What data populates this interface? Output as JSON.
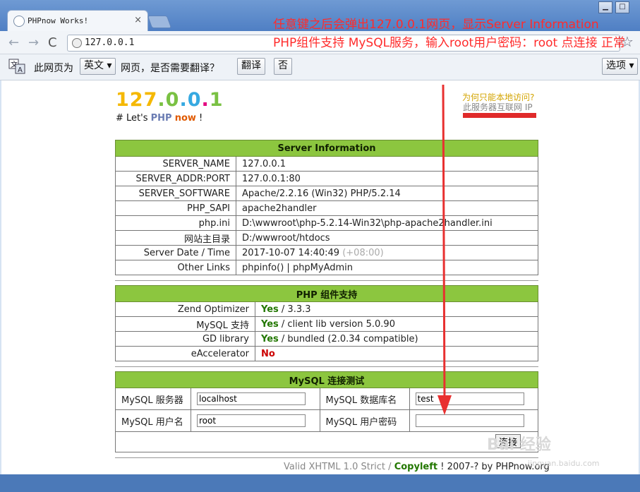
{
  "window": {
    "tab_title": "PHPnow Works!",
    "tab_close": "×",
    "minimize": "▁",
    "maximize": "□"
  },
  "toolbar": {
    "back": "←",
    "forward": "→",
    "reload": "C",
    "url": "127.0.0.1",
    "star": "☆"
  },
  "translate_bar": {
    "prefix": "此网页为",
    "language": "英文",
    "question": "网页，是否需要翻译？",
    "translate_label": "翻译",
    "no_label": "否",
    "options_label": "选项"
  },
  "page": {
    "logo": [
      "1",
      "2",
      "7",
      ".",
      "0",
      ".",
      "0",
      ".",
      "1"
    ],
    "logo_colors": [
      "#f5b800",
      "#f5b800",
      "#f5b800",
      "#7ac143",
      "#7ac143",
      "#36a9e1",
      "#36a9e1",
      "#e4007f",
      "#7ac143"
    ],
    "slogan_prefix": "# Let's ",
    "slogan_php": "PHP",
    "slogan_now": "now",
    "slogan_suffix": " !",
    "why_local": "为何只能本地访问?",
    "internet_ip": "此服务器互联网 IP",
    "server_info": {
      "title": "Server Information",
      "rows": [
        {
          "key": "SERVER_NAME",
          "value": "127.0.0.1"
        },
        {
          "key": "SERVER_ADDR:PORT",
          "value": "127.0.0.1:80"
        },
        {
          "key": "SERVER_SOFTWARE",
          "value": "Apache/2.2.16 (Win32) PHP/5.2.14"
        },
        {
          "key": "PHP_SAPI",
          "value": "apache2handler"
        },
        {
          "key": "php.ini",
          "value": "D:\\wwwroot\\php-5.2.14-Win32\\php-apache2handler.ini"
        },
        {
          "key": "网站主目录",
          "value": "D:/wwwroot/htdocs"
        },
        {
          "key": "Server Date / Time",
          "value": "2017-10-07 14:40:49",
          "extra": "(+08:00)"
        },
        {
          "key": "Other Links",
          "link1": "phpinfo()",
          "sep": " | ",
          "link2": "phpMyAdmin"
        }
      ]
    },
    "php_components": {
      "title": "PHP 组件支持",
      "rows": [
        {
          "key": "Zend Optimizer",
          "status": "Yes",
          "detail": " / 3.3.3"
        },
        {
          "key": "MySQL 支持",
          "status": "Yes",
          "detail": " / client lib version 5.0.90"
        },
        {
          "key": "GD library",
          "status": "Yes",
          "detail": " / bundled (2.0.34 compatible)"
        },
        {
          "key": "eAccelerator",
          "status": "No",
          "detail": ""
        }
      ]
    },
    "mysql_test": {
      "title": "MySQL 连接测试",
      "server_label": "MySQL 服务器",
      "server_value": "localhost",
      "db_label": "MySQL 数据库名",
      "db_value": "test",
      "user_label": "MySQL 用户名",
      "user_value": "root",
      "pass_label": "MySQL 用户密码",
      "pass_value": "",
      "connect_label": "连接"
    },
    "footer": {
      "valid": "Valid XHTML 1.0 Strict",
      "slash": " / ",
      "copyleft": "Copyleft",
      "rest": " ! 2007-? by PHPnow.org"
    }
  },
  "annotation": {
    "text": "任意键之后会弹出127.0.0.1网页，显示Server Information PHP组件支持  MySQL服务，输入root用户密码：root 点连接 正常",
    "color": "#ff2b2b"
  },
  "watermark": {
    "text": "Bai 经验",
    "url": "jingyan.baidu.com"
  }
}
